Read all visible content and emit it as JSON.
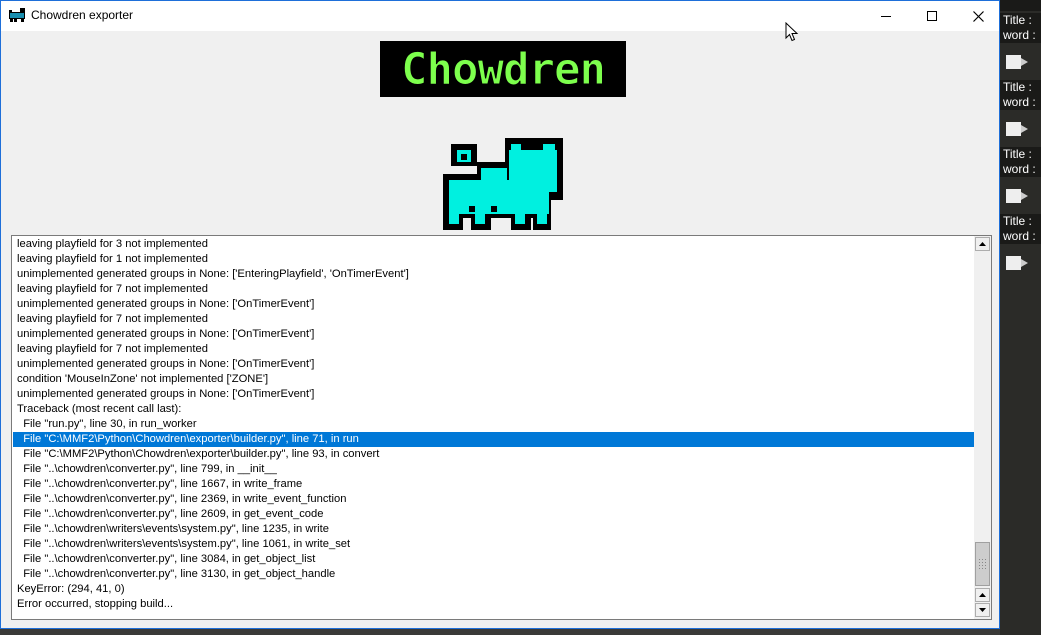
{
  "window": {
    "title": "Chowdren exporter",
    "icon": "chowdren-cat-icon",
    "controls": [
      "minimize-icon",
      "maximize-icon",
      "close-icon"
    ]
  },
  "logo": {
    "text": "Chowdren",
    "colors": {
      "logo_fill": "#7dff4d",
      "cat_fill": "#00f0e0",
      "outline": "#000000"
    }
  },
  "log": {
    "selected_index": 13,
    "lines": [
      "leaving playfield for 3 not implemented",
      "leaving playfield for 1 not implemented",
      "unimplemented generated groups in None: ['EnteringPlayfield', 'OnTimerEvent']",
      "leaving playfield for 7 not implemented",
      "unimplemented generated groups in None: ['OnTimerEvent']",
      "leaving playfield for 7 not implemented",
      "unimplemented generated groups in None: ['OnTimerEvent']",
      "leaving playfield for 7 not implemented",
      "unimplemented generated groups in None: ['OnTimerEvent']",
      "condition 'MouseInZone' not implemented ['ZONE']",
      "unimplemented generated groups in None: ['OnTimerEvent']",
      "Traceback (most recent call last):",
      "  File \"run.py\", line 30, in run_worker",
      "  File \"C:\\MMF2\\Python\\Chowdren\\exporter\\builder.py\", line 71, in run",
      "  File \"C:\\MMF2\\Python\\Chowdren\\exporter\\builder.py\", line 93, in convert",
      "  File \"..\\chowdren\\converter.py\", line 799, in __init__",
      "  File \"..\\chowdren\\converter.py\", line 1667, in write_frame",
      "  File \"..\\chowdren\\converter.py\", line 2369, in write_event_function",
      "  File \"..\\chowdren\\converter.py\", line 2609, in get_event_code",
      "  File \"..\\chowdren\\writers\\events\\system.py\", line 1235, in write",
      "  File \"..\\chowdren\\writers\\events\\system.py\", line 1061, in write_set",
      "  File \"..\\chowdren\\converter.py\", line 3084, in get_object_list",
      "  File \"..\\chowdren\\converter.py\", line 3130, in get_object_handle",
      "KeyError: (294, 41, 0)",
      "Error occurred, stopping build..."
    ]
  },
  "side_panel": {
    "items": [
      {
        "title_label": "Title :",
        "word_label": "word :"
      },
      {
        "title_label": "Title :",
        "word_label": "word :"
      },
      {
        "title_label": "Title :",
        "word_label": "word :"
      },
      {
        "title_label": "Title :",
        "word_label": "word :"
      }
    ]
  }
}
